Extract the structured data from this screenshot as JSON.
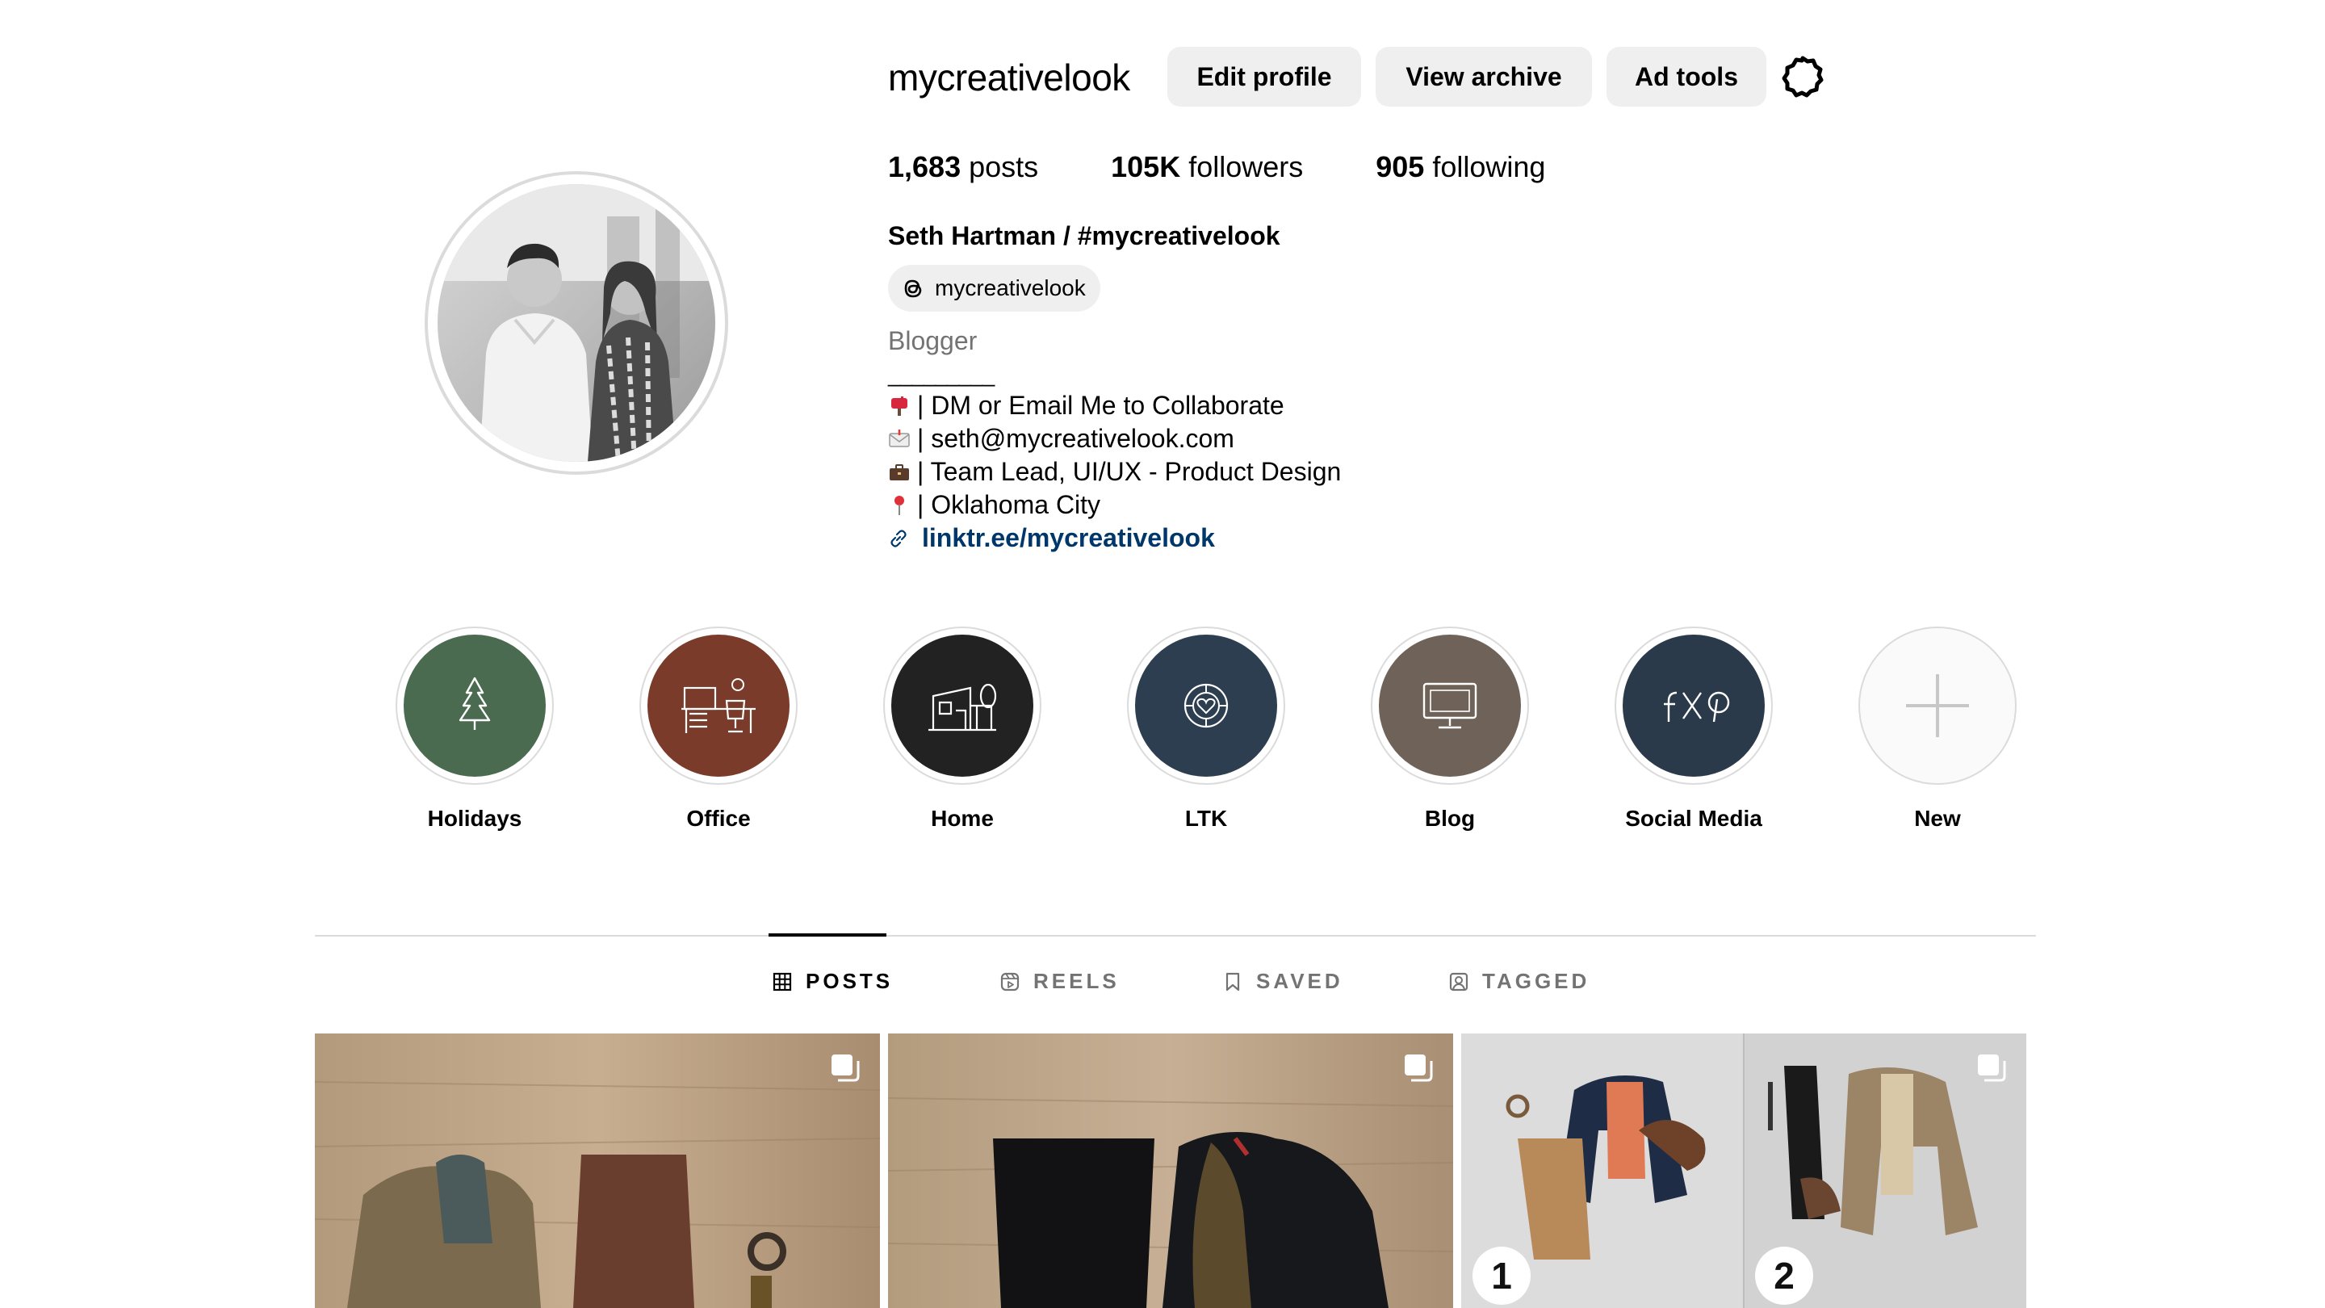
{
  "profile": {
    "username": "mycreativelook",
    "buttons": {
      "edit": "Edit profile",
      "archive": "View archive",
      "ad_tools": "Ad tools"
    },
    "stats": [
      {
        "value": "1,683",
        "label": "posts"
      },
      {
        "value": "105K",
        "label": "followers"
      },
      {
        "value": "905",
        "label": "following"
      }
    ],
    "full_name": "Seth Hartman / #mycreativelook",
    "threads_handle": "mycreativelook",
    "category": "Blogger",
    "divider": "_________",
    "bio": [
      {
        "icon": "mailbox-icon",
        "text": "| DM or Email Me to Collaborate"
      },
      {
        "icon": "envelope-icon",
        "text": "| seth@mycreativelook.com"
      },
      {
        "icon": "briefcase-icon",
        "text": "| Team Lead, UI/UX - Product Design"
      },
      {
        "icon": "pin-icon",
        "text": "| Oklahoma City"
      }
    ],
    "link": "linktr.ee/mycreativelook"
  },
  "highlights": [
    {
      "label": "Holidays",
      "color": "#4a6b50",
      "icon": "tree-icon"
    },
    {
      "label": "Office",
      "color": "#7a3b2a",
      "icon": "desk-icon"
    },
    {
      "label": "Home",
      "color": "#222222",
      "icon": "house-icon"
    },
    {
      "label": "LTK",
      "color": "#2c3e4f",
      "icon": "ltk-heart-icon"
    },
    {
      "label": "Blog",
      "color": "#6f6259",
      "icon": "monitor-icon"
    },
    {
      "label": "Social Media",
      "color": "#2a3a4b",
      "icon": "social-icons"
    },
    {
      "label": "New",
      "color": "#ffffff",
      "icon": "plus-icon"
    }
  ],
  "tabs": [
    "POSTS",
    "REELS",
    "SAVED",
    "TAGGED"
  ],
  "posts": [
    {
      "type": "carousel"
    },
    {
      "type": "carousel"
    },
    {
      "type": "carousel",
      "badges": [
        "1",
        "2"
      ]
    }
  ]
}
